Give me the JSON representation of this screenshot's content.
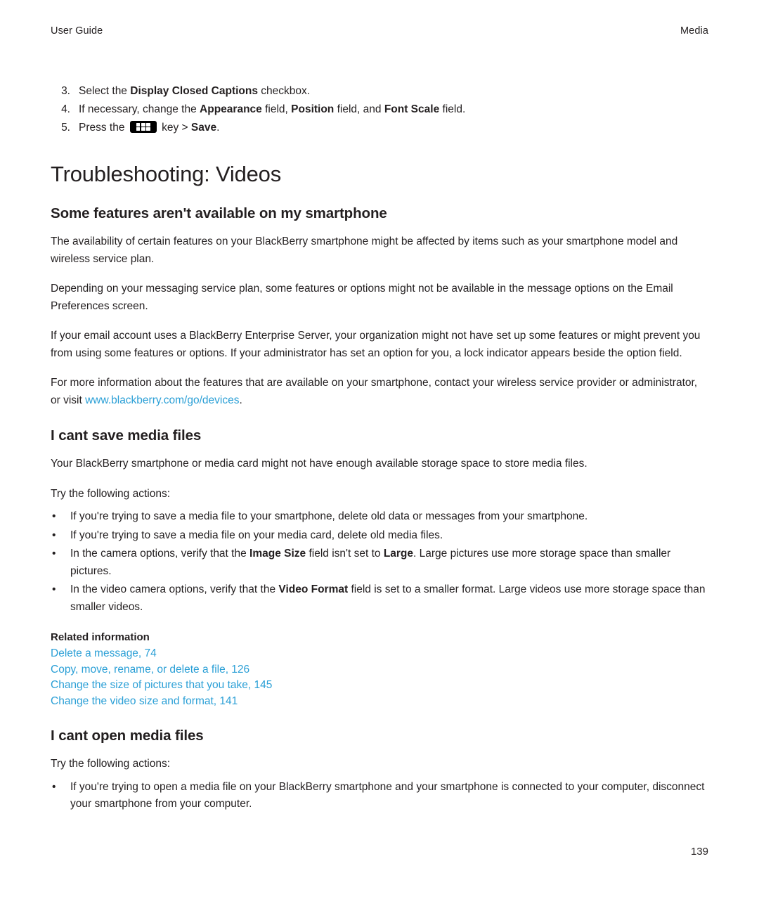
{
  "header": {
    "left": "User Guide",
    "right": "Media"
  },
  "steps": [
    {
      "num": "3.",
      "parts": [
        {
          "t": "Select the ",
          "b": false
        },
        {
          "t": "Display Closed Captions",
          "b": true
        },
        {
          "t": " checkbox.",
          "b": false
        }
      ]
    },
    {
      "num": "4.",
      "parts": [
        {
          "t": "If necessary, change the ",
          "b": false
        },
        {
          "t": "Appearance",
          "b": true
        },
        {
          "t": " field, ",
          "b": false
        },
        {
          "t": "Position",
          "b": true
        },
        {
          "t": " field, and ",
          "b": false
        },
        {
          "t": "Font Scale",
          "b": true
        },
        {
          "t": " field.",
          "b": false
        }
      ]
    },
    {
      "num": "5.",
      "parts": [
        {
          "t": "Press the ",
          "b": false
        },
        {
          "t": "__BBKEY__",
          "b": false
        },
        {
          "t": " key > ",
          "b": false
        },
        {
          "t": "Save",
          "b": true
        },
        {
          "t": ".",
          "b": false
        }
      ]
    }
  ],
  "title": "Troubleshooting: Videos",
  "section1": {
    "heading": "Some features aren't available on my smartphone",
    "paragraphs": [
      "The availability of certain features on your BlackBerry smartphone might be affected by items such as your smartphone model and wireless service plan.",
      "Depending on your messaging service plan, some features or options might not be available in the message options on the Email Preferences screen.",
      "If your email account uses a BlackBerry Enterprise Server, your organization might not have set up some features or might prevent you from using some features or options. If your administrator has set an option for you, a lock indicator appears beside the option field."
    ],
    "last_paragraph_pre": "For more information about the features that are available on your smartphone, contact your wireless service provider or administrator, or visit ",
    "last_paragraph_link": "www.blackberry.com/go/devices",
    "last_paragraph_post": "."
  },
  "section2": {
    "heading": "I cant save media files",
    "intro": "Your BlackBerry smartphone or media card might not have enough available storage space to store media files.",
    "try_label": "Try the following actions:",
    "bullets": [
      [
        {
          "t": "If you're trying to save a media file to your smartphone, delete old data or messages from your smartphone.",
          "b": false
        }
      ],
      [
        {
          "t": "If you're trying to save a media file on your media card, delete old media files.",
          "b": false
        }
      ],
      [
        {
          "t": "In the camera options, verify that the ",
          "b": false
        },
        {
          "t": "Image Size",
          "b": true
        },
        {
          "t": " field isn't set to ",
          "b": false
        },
        {
          "t": "Large",
          "b": true
        },
        {
          "t": ". Large pictures use more storage space than smaller pictures.",
          "b": false
        }
      ],
      [
        {
          "t": "In the video camera options, verify that the ",
          "b": false
        },
        {
          "t": "Video Format",
          "b": true
        },
        {
          "t": " field is set to a smaller format. Large videos use more storage space than smaller videos.",
          "b": false
        }
      ]
    ],
    "related_title": "Related information",
    "related_links": [
      "Delete a message, 74",
      "Copy, move, rename, or delete a file, 126",
      "Change the size of pictures that you take, 145",
      "Change the video size and format, 141"
    ]
  },
  "section3": {
    "heading": "I cant open media files",
    "try_label": "Try the following actions:",
    "bullets": [
      [
        {
          "t": "If you're trying to open a media file on your BlackBerry smartphone and your smartphone is connected to your computer, disconnect your smartphone from your computer.",
          "b": false
        }
      ]
    ]
  },
  "page_number": "139",
  "colors": {
    "link": "#2a9fd6",
    "text": "#231f20"
  }
}
